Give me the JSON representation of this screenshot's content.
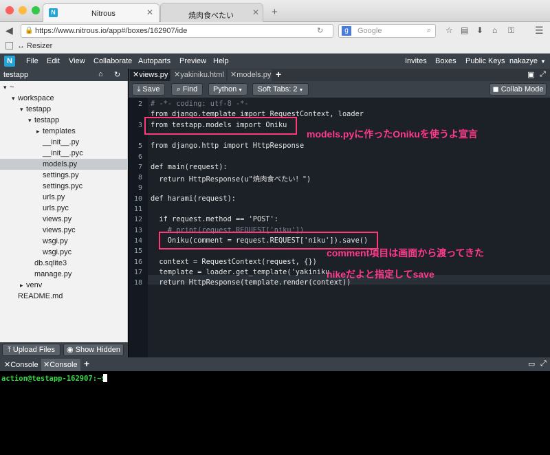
{
  "browser": {
    "tabs": [
      {
        "title": "Nitrous"
      },
      {
        "title": "焼肉食べたい"
      }
    ],
    "url": "https://www.nitrous.io/app#/boxes/162907/ide",
    "search_placeholder": "Google",
    "bookmark": "↔ Resizer"
  },
  "menu": {
    "items": [
      "File",
      "Edit",
      "View",
      "Collaborate",
      "Autoparts",
      "Preview",
      "Help"
    ],
    "right": [
      "Invites",
      "Boxes",
      "Public Keys",
      "nakazye"
    ]
  },
  "sidebar": {
    "title": "testapp",
    "tree": [
      {
        "label": "~",
        "indent": 0,
        "arrow": "▾"
      },
      {
        "label": "workspace",
        "indent": 1,
        "arrow": "▾"
      },
      {
        "label": "testapp",
        "indent": 2,
        "arrow": "▾"
      },
      {
        "label": "testapp",
        "indent": 3,
        "arrow": "▾"
      },
      {
        "label": "templates",
        "indent": 4,
        "arrow": "▸"
      },
      {
        "label": "__init__.py",
        "indent": 4,
        "arrow": ""
      },
      {
        "label": "__init__.pyc",
        "indent": 4,
        "arrow": ""
      },
      {
        "label": "models.py",
        "indent": 4,
        "arrow": "",
        "selected": true
      },
      {
        "label": "settings.py",
        "indent": 4,
        "arrow": ""
      },
      {
        "label": "settings.pyc",
        "indent": 4,
        "arrow": ""
      },
      {
        "label": "urls.py",
        "indent": 4,
        "arrow": ""
      },
      {
        "label": "urls.pyc",
        "indent": 4,
        "arrow": ""
      },
      {
        "label": "views.py",
        "indent": 4,
        "arrow": ""
      },
      {
        "label": "views.pyc",
        "indent": 4,
        "arrow": ""
      },
      {
        "label": "wsgi.py",
        "indent": 4,
        "arrow": ""
      },
      {
        "label": "wsgi.pyc",
        "indent": 4,
        "arrow": ""
      },
      {
        "label": "db.sqlite3",
        "indent": 3,
        "arrow": ""
      },
      {
        "label": "manage.py",
        "indent": 3,
        "arrow": ""
      },
      {
        "label": "venv",
        "indent": 2,
        "arrow": "▸"
      },
      {
        "label": "README.md",
        "indent": 1,
        "arrow": ""
      }
    ],
    "upload_label": "Upload Files",
    "hidden_label": "Show Hidden"
  },
  "editor": {
    "tabs": [
      "views.py",
      "yakiniku.html",
      "models.py"
    ],
    "toolbar": {
      "save": "Save",
      "find": "Find",
      "lang": "Python",
      "tabs": "Soft Tabs: 2",
      "collab": "Collab Mode"
    },
    "lines": [
      {
        "n": "2",
        "t": "# -*- coding: utf-8 -*-"
      },
      {
        "n": "",
        "t": "from django.template import RequestContext, loader"
      },
      {
        "n": "3",
        "t": "from testapp.models import Oniku"
      },
      {
        "n": "",
        "t": ""
      },
      {
        "n": "5",
        "t": "from django.http import HttpResponse"
      },
      {
        "n": "6",
        "t": ""
      },
      {
        "n": "7",
        "t": "def main(request):"
      },
      {
        "n": "8",
        "t": "  return HttpResponse(u\"焼肉食べたい！\")"
      },
      {
        "n": "9",
        "t": ""
      },
      {
        "n": "10",
        "t": "def harami(request):"
      },
      {
        "n": "11",
        "t": ""
      },
      {
        "n": "12",
        "t": "  if request.method == 'POST':"
      },
      {
        "n": "13",
        "t": "    # print(request.REQUEST['niku'])"
      },
      {
        "n": "14",
        "t": "    Oniku(comment = request.REQUEST['niku']).save()"
      },
      {
        "n": "15",
        "t": ""
      },
      {
        "n": "16",
        "t": "  context = RequestContext(request, {})"
      },
      {
        "n": "17",
        "t": "  template = loader.get_template('yakiniku"
      },
      {
        "n": "18",
        "t": "  return HttpResponse(template.render(context))"
      }
    ]
  },
  "annotations": {
    "note1": "models.pyに作ったOnikuを使うよ宣言",
    "note2a": "comment項目は画面から渡ってきた",
    "note2b": "nikeだよと指定してsave"
  },
  "console": {
    "tabs": [
      "Console",
      "Console"
    ],
    "prompt": "action@testapp-162907:~$"
  }
}
